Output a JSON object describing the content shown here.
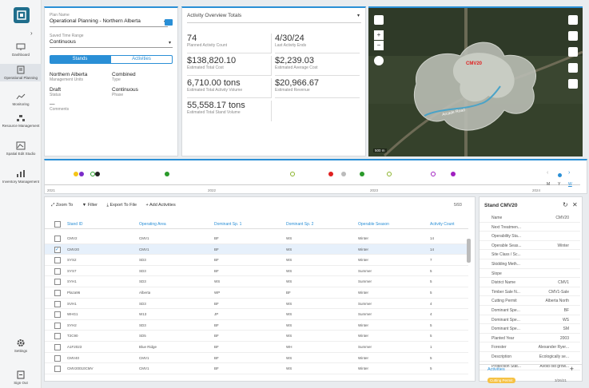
{
  "nav": {
    "items": [
      {
        "label": "Dashboard"
      },
      {
        "label": "Operational Planning"
      },
      {
        "label": "Monitoring"
      },
      {
        "label": "Resource Management"
      },
      {
        "label": "Spatial Edit Studio"
      },
      {
        "label": "Inventory Management"
      },
      {
        "label": "Settings"
      },
      {
        "label": "Sign Out"
      }
    ]
  },
  "plan": {
    "name_label": "Plan Name",
    "name_value": "Operational Planning - Northern Alberta",
    "range_label": "Saved Time Range",
    "range_value": "Continuous",
    "tab_stands": "Stands",
    "tab_activities": "Activities",
    "fields": [
      {
        "value": "Northern Alberta",
        "label": "Management Units"
      },
      {
        "value": "Combined",
        "label": "Type"
      },
      {
        "value": "Draft",
        "label": "Status"
      },
      {
        "value": "Continuous",
        "label": "Phase"
      },
      {
        "value": "—",
        "label": "Comments"
      }
    ]
  },
  "overview": {
    "title": "Activity Overview Totals",
    "metrics": [
      {
        "value": "74",
        "label": "Planned Activity Count"
      },
      {
        "value": "4/30/24",
        "label": "Last Activity Ends"
      },
      {
        "value": "$138,820.10",
        "label": "Estimated Total Cost"
      },
      {
        "value": "$2,239.03",
        "label": "Estimated Average Cost"
      },
      {
        "value": "6,710.00 tons",
        "label": "Estimated Total Activity Volume"
      },
      {
        "value": "$20,966.67",
        "label": "Estimated Revenue"
      },
      {
        "value": "55,558.17 tons",
        "label": "Estimated Total Stand Volume"
      }
    ]
  },
  "map": {
    "stand_label": "CMV20",
    "road_label": "Arcade Road",
    "scale": "500 m"
  },
  "timeline": {
    "years": [
      "2021",
      "2022",
      "2023",
      "2024"
    ],
    "legend": [
      "M",
      "Y",
      "W"
    ]
  },
  "toolbar": {
    "zoom": "Zoom To",
    "filter": "Filter",
    "export": "Export To File",
    "add": "Add Activities",
    "count": "5/93"
  },
  "table": {
    "headers": [
      "Stand ID",
      "Operating Area",
      "Dominant Sp. 1",
      "Dominant Sp. 2",
      "Operable Season",
      "Activity Count"
    ],
    "rows": [
      [
        "CMV2",
        "CMV1",
        "BF",
        "WS",
        "Winter",
        "14"
      ],
      [
        "CMV20",
        "CMV1",
        "BF",
        "WS",
        "Winter",
        "14"
      ],
      [
        "SYS2",
        "SD3",
        "BF",
        "WS",
        "Winter",
        "7"
      ],
      [
        "SYS7",
        "SD3",
        "BF",
        "WS",
        "Summer",
        "5"
      ],
      [
        "SYH1",
        "SD3",
        "WS",
        "WS",
        "Summer",
        "5"
      ],
      [
        "Plaza96",
        "Alberta",
        "WP",
        "BF",
        "Winter",
        "5"
      ],
      [
        "SVH1",
        "SD3",
        "BF",
        "WS",
        "Summer",
        "4"
      ],
      [
        "WHG1",
        "W13",
        "JP",
        "WS",
        "Summer",
        "4"
      ],
      [
        "SYH2",
        "SD3",
        "BF",
        "WS",
        "Winter",
        "5"
      ],
      [
        "T2C90",
        "SD5",
        "BF",
        "WS",
        "Winter",
        "5"
      ],
      [
        "A1F2023",
        "Blue Ridge",
        "BF",
        "WH",
        "Summer",
        "1"
      ],
      [
        "CMV40",
        "CMV1",
        "BF",
        "WS",
        "Winter",
        "5"
      ],
      [
        "CMV20010CMV",
        "CMV1",
        "BF",
        "WS",
        "Winter",
        "5"
      ]
    ]
  },
  "details": {
    "title": "Stand CMV20",
    "props": [
      [
        "Name",
        "CMV20"
      ],
      [
        "Next Treatmen...",
        ""
      ],
      [
        "Operability Sta...",
        ""
      ],
      [
        "Operable Seas...",
        "Winter"
      ],
      [
        "Site Class / Sc...",
        ""
      ],
      [
        "Skidding Meth...",
        ""
      ],
      [
        "Slope",
        ""
      ],
      [
        "District Name",
        "CMV1"
      ],
      [
        "Timber Sale N...",
        "CMV1-Sale"
      ],
      [
        "Cutting Permit",
        "Alberta North"
      ],
      [
        "Dominant Spe...",
        "BF"
      ],
      [
        "Dominant Spe...",
        "WS"
      ],
      [
        "Dominant Spe...",
        "SM"
      ],
      [
        "Planted Year",
        "2003"
      ],
      [
        "Forester",
        "Alexander Ryer..."
      ],
      [
        "Description",
        "Ecologically se..."
      ],
      [
        "Protection Stat...",
        "Avoid old grow..."
      ]
    ],
    "activities_label": "Activities",
    "chip": "Cutting Permit",
    "chip_date": "3/26/21"
  }
}
